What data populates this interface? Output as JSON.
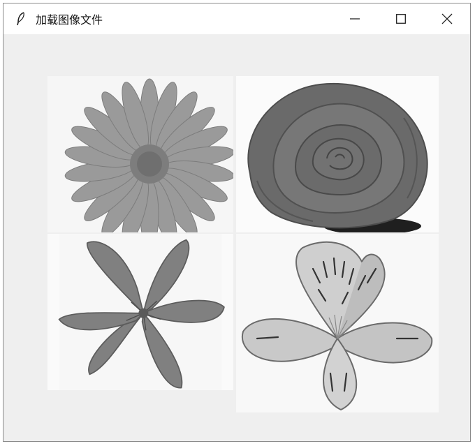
{
  "window": {
    "title": "加载图像文件",
    "app_icon": "feather-icon",
    "controls": [
      "minimize-icon",
      "maximize-icon",
      "close-icon"
    ]
  },
  "images": [
    {
      "name": "daisy-image",
      "position": "top-left"
    },
    {
      "name": "rose-image",
      "position": "top-right"
    },
    {
      "name": "lily-image",
      "position": "bottom-left"
    },
    {
      "name": "alstroemeria-image",
      "position": "bottom-right"
    }
  ]
}
